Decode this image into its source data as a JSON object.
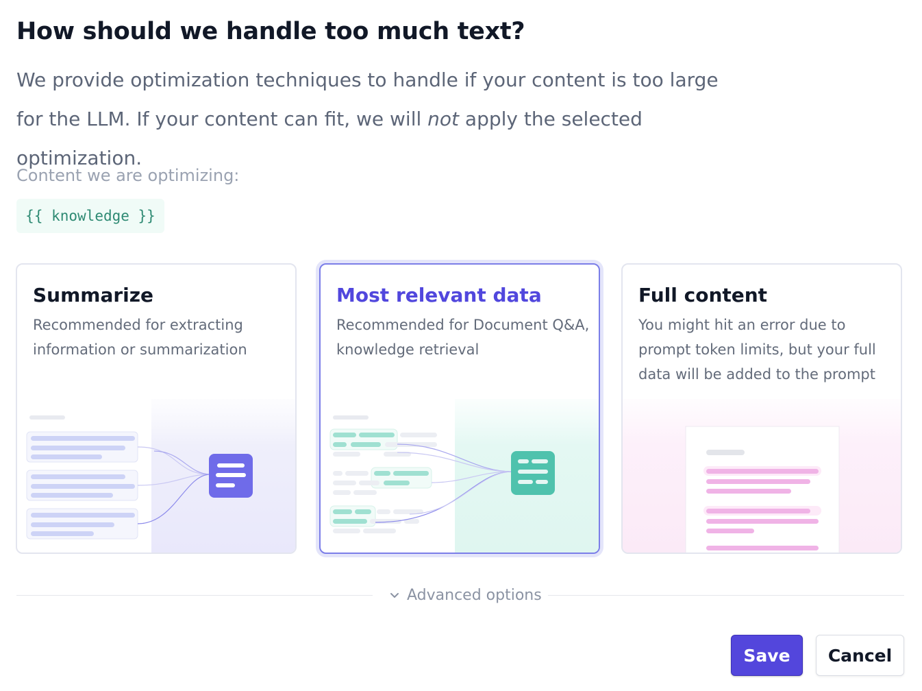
{
  "header": {
    "title": "How should we handle too much text?",
    "desc_part1": "We provide optimization techniques to handle if your content is too large for the LLM. If your content can fit, we will ",
    "desc_emphasis": "not",
    "desc_part2": " apply the selected optimization."
  },
  "content": {
    "label": "Content we are optimizing:",
    "variable": "{{ knowledge }}"
  },
  "options": [
    {
      "title": "Summarize",
      "description": "Recommended for extracting information or summarization",
      "selected": false
    },
    {
      "title": "Most relevant data",
      "description": "Recommended for Document Q&A, knowledge retrieval",
      "selected": true
    },
    {
      "title": "Full content",
      "description": "You might hit an error due to prompt token limits, but your full data will be added to the prompt",
      "selected": false
    }
  ],
  "advanced": {
    "label": "Advanced options",
    "icon": "chevron-down-icon"
  },
  "actions": {
    "save_label": "Save",
    "cancel_label": "Cancel"
  },
  "colors": {
    "accent": "#5346dc",
    "selected_border": "#7b7ee8",
    "summarize_art": "#7472ef",
    "relevant_art": "#53c5b1",
    "full_art": "#f0b3e6"
  }
}
